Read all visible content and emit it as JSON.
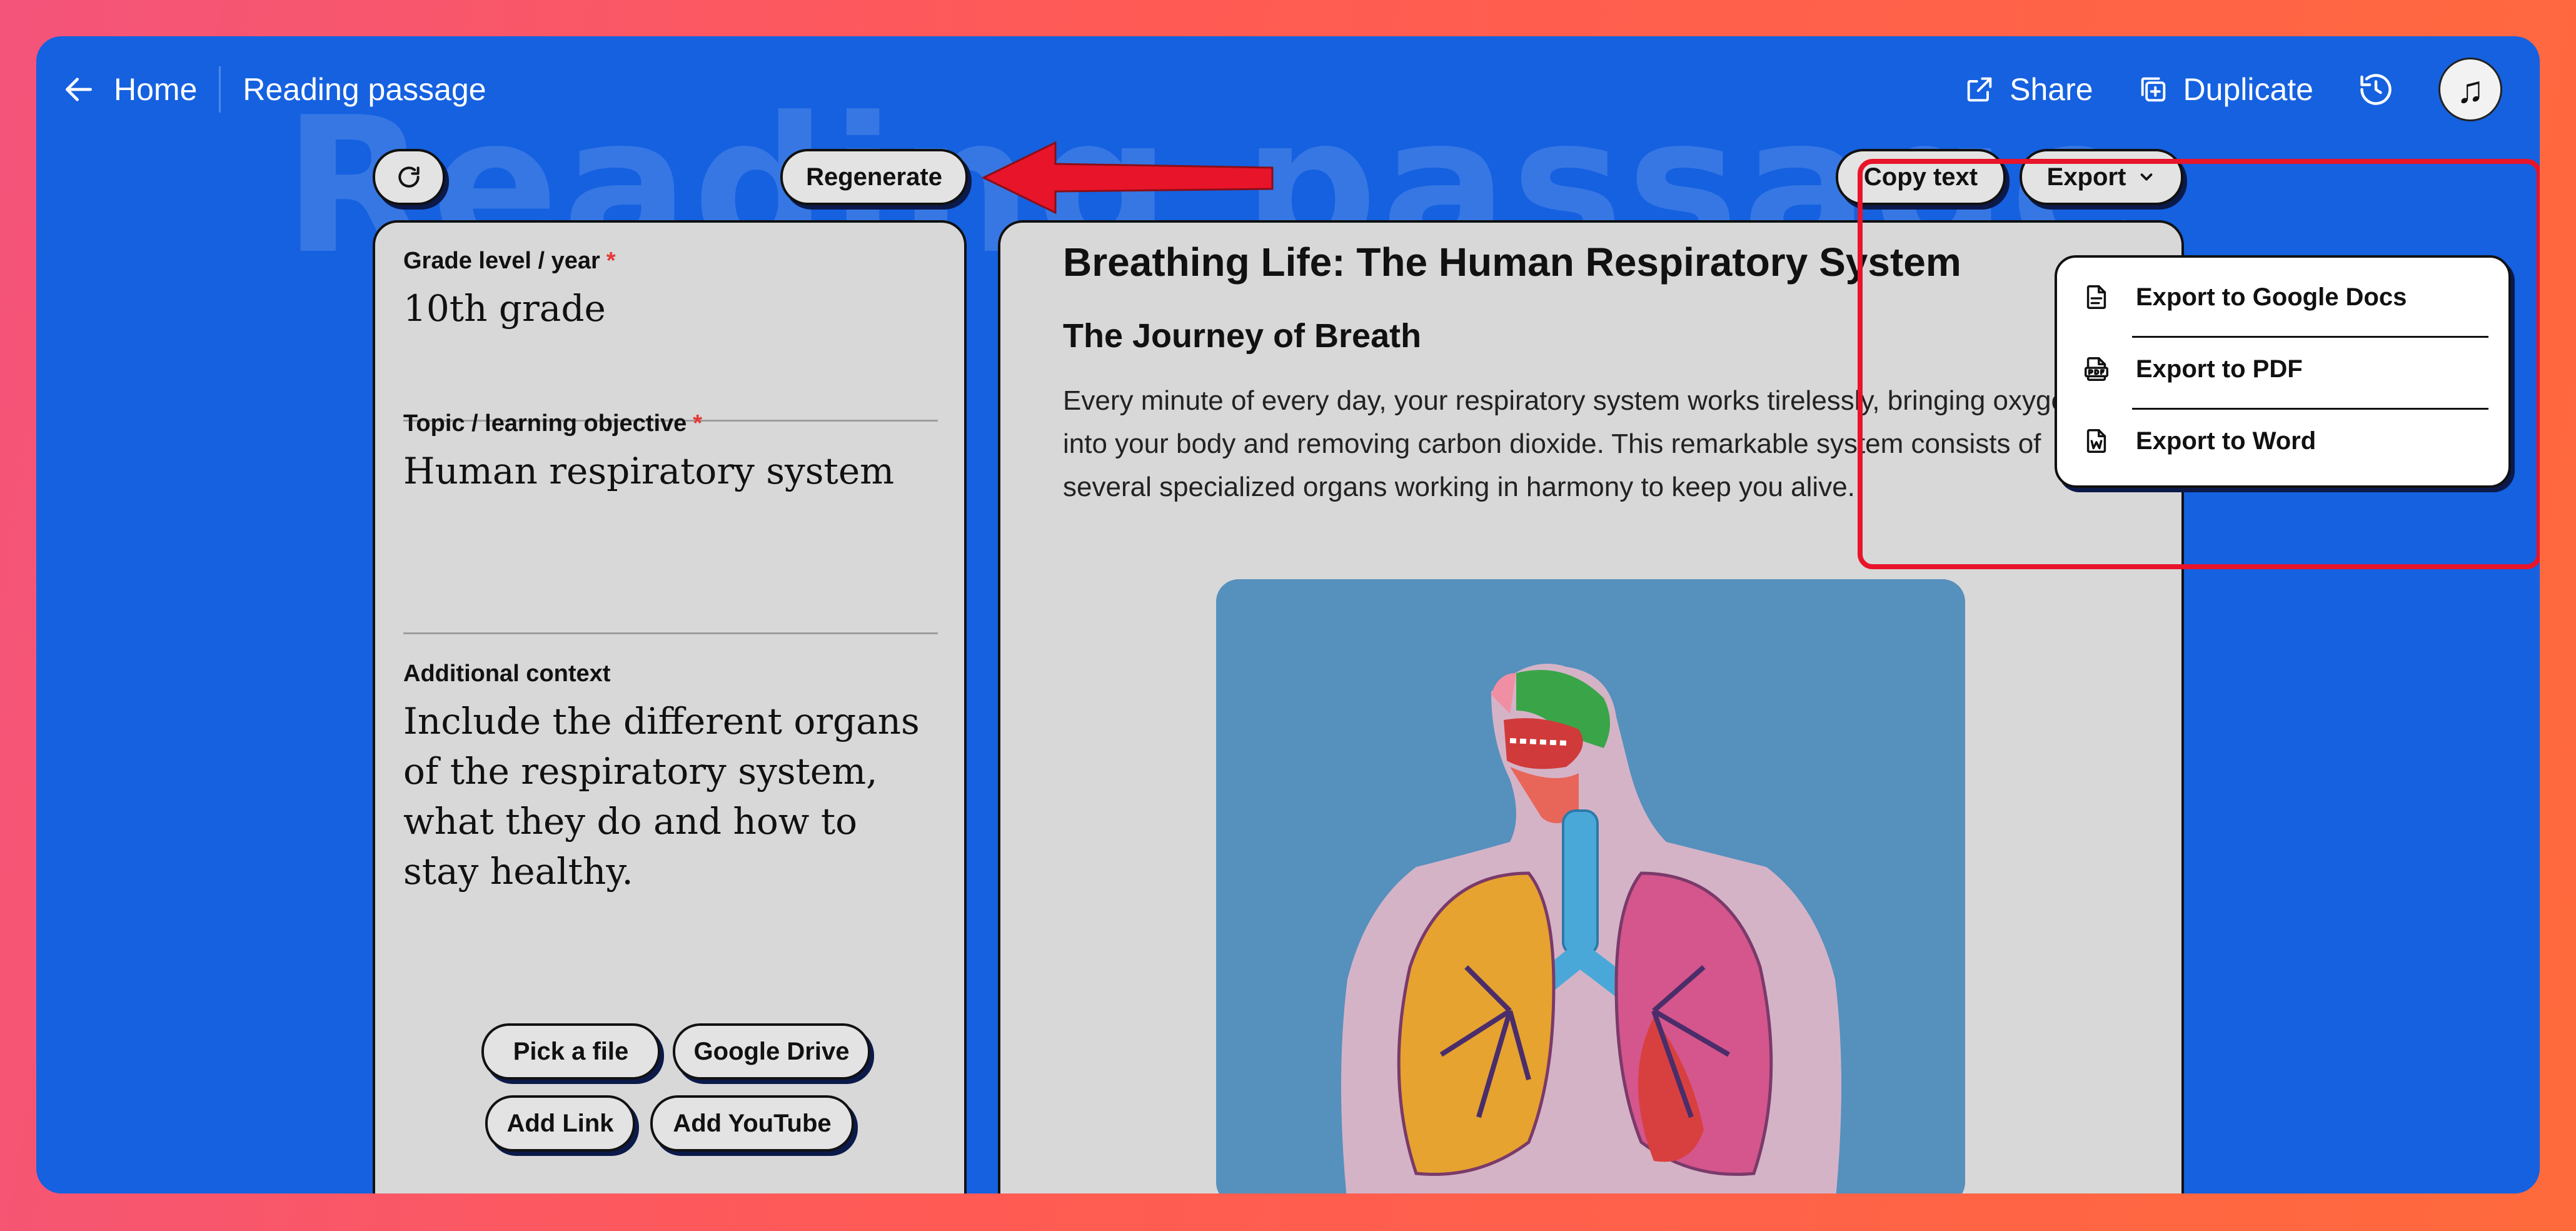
{
  "topbar": {
    "home_label": "Home",
    "page_title": "Reading passage",
    "share_label": "Share",
    "duplicate_label": "Duplicate"
  },
  "watermark_text": "Reading passage",
  "toolbar": {
    "regenerate_label": "Regenerate",
    "copy_text_label": "Copy text",
    "export_label": "Export"
  },
  "form": {
    "grade": {
      "label": "Grade level / year",
      "value": "10th grade"
    },
    "topic": {
      "label": "Topic / learning objective",
      "value": "Human respiratory system"
    },
    "context": {
      "label": "Additional context",
      "value": "Include the different organs of the respiratory system, what they do and how to stay healthy."
    },
    "attachments": {
      "pick_file": "Pick a file",
      "google_drive": "Google Drive",
      "add_link": "Add Link",
      "add_youtube": "Add YouTube"
    }
  },
  "document": {
    "title": "Breathing Life: The Human Respiratory System",
    "subtitle": "The Journey of Breath",
    "paragraph": "Every minute of every day, your respiratory system works tirelessly, bringing oxygen into your body and removing carbon dioxide. This remarkable system consists of several specialized organs working in harmony to keep you alive."
  },
  "export_menu": {
    "items": [
      {
        "label": "Export to Google Docs",
        "icon": "doc-icon"
      },
      {
        "label": "Export to PDF",
        "icon": "pdf-icon"
      },
      {
        "label": "Export to Word",
        "icon": "word-icon"
      }
    ]
  },
  "colors": {
    "background_primary": "#1561e0",
    "annotation_red": "#e8142a",
    "required_marker": "#e53935"
  }
}
